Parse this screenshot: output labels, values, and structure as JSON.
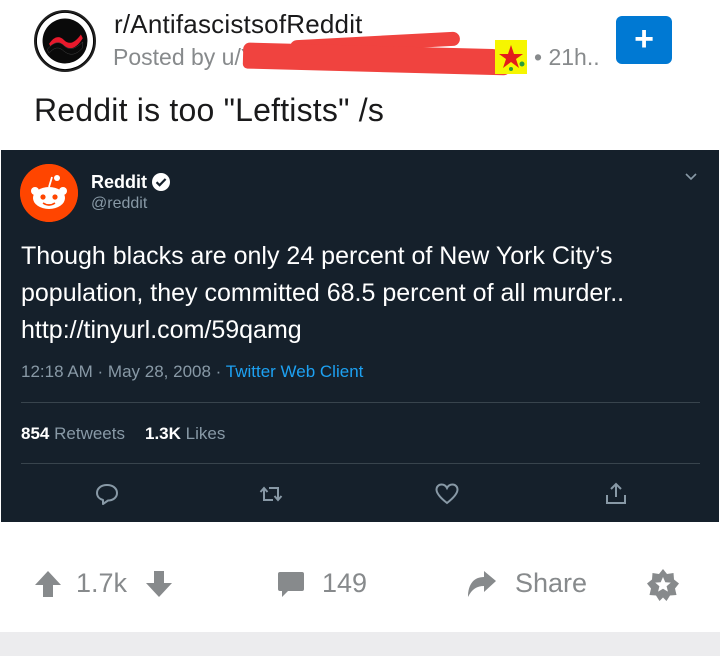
{
  "post": {
    "subreddit": "r/AntifascistsofReddit",
    "posted_by_prefix": "Posted by u/",
    "posted_by_visible": "Y",
    "time_separator": "•",
    "time": "21h..",
    "title": "Reddit is too \"Leftists\" /s",
    "join_label": "+"
  },
  "tweet": {
    "name": "Reddit",
    "handle": "@reddit",
    "text": "Though blacks are only 24 percent of New York City’s population, they committed 68.5 percent of all murder.. http://tinyurl.com/59qamg",
    "time": "12:18 AM · May 28, 2008 · ",
    "client": "Twitter Web Client",
    "retweets_count": "854",
    "retweets_label": "Retweets",
    "likes_count": "1.3K",
    "likes_label": "Likes"
  },
  "actions": {
    "votes": "1.7k",
    "comments": "149",
    "share_label": "Share"
  },
  "colors": {
    "reddit_blue": "#0079d3",
    "tweet_bg": "#15202b",
    "twitter_blue": "#1da1f2",
    "redaction": "#f0433f",
    "reddit_orange": "#ff4500",
    "muted": "#878a8c"
  },
  "icons": {
    "subreddit_avatar": "antifa-flag-icon",
    "flair": "star-flair-icon",
    "verified": "verified-badge-icon",
    "caret": "chevron-down-icon",
    "reply": "reply-icon",
    "retweet": "retweet-icon",
    "like": "heart-icon",
    "share_tweet": "share-icon",
    "upvote": "upvote-arrow-icon",
    "downvote": "downvote-arrow-icon",
    "comment": "comment-icon",
    "share": "share-arrow-icon",
    "award": "award-icon"
  }
}
